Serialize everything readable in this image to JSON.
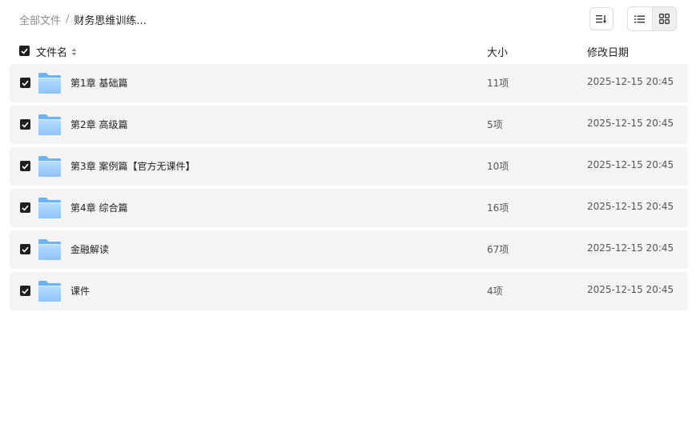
{
  "breadcrumb": {
    "root": "全部文件",
    "separator": "/",
    "current": "财务思维训练..."
  },
  "toolbar": {
    "sort_icon": "sort-icon",
    "list_view_icon": "list-view-icon",
    "grid_view_icon": "grid-view-icon"
  },
  "table": {
    "columns": {
      "name": "文件名",
      "size": "大小",
      "date": "修改日期"
    },
    "rows": [
      {
        "name": "第1章 基础篇",
        "size": "11项",
        "date": "2025-12-15 20:45",
        "checked": true
      },
      {
        "name": "第2章 高级篇",
        "size": "5项",
        "date": "2025-12-15 20:45",
        "checked": true
      },
      {
        "name": "第3章 案例篇【官方无课件】",
        "size": "10项",
        "date": "2025-12-15 20:45",
        "checked": true
      },
      {
        "name": "第4章 综合篇",
        "size": "16项",
        "date": "2025-12-15 20:45",
        "checked": true
      },
      {
        "name": "金融解读",
        "size": "67项",
        "date": "2025-12-15 20:45",
        "checked": true
      },
      {
        "name": "课件",
        "size": "4项",
        "date": "2025-12-15 20:45",
        "checked": true
      }
    ]
  },
  "colors": {
    "accent_dark": "#1f1f1f",
    "row_bg": "#f4f4f4",
    "folder_light": "#a9d3ff",
    "folder_dark": "#6cb4f5"
  }
}
